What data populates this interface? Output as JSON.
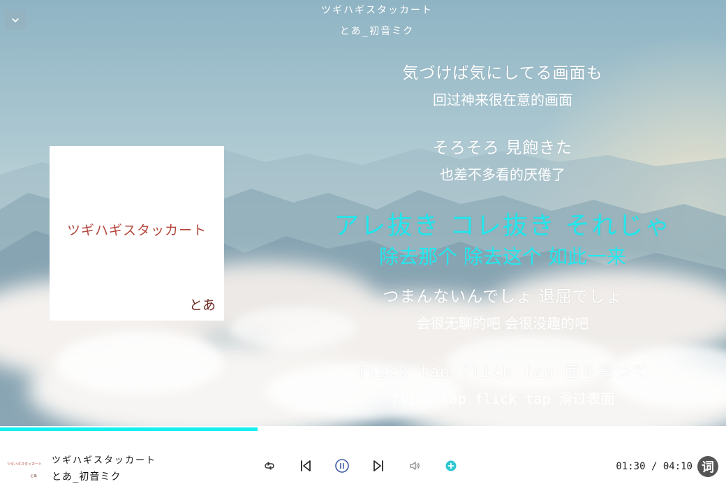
{
  "song": {
    "title": "ツギハギスタッカート",
    "artist": "とあ_初音ミク"
  },
  "cover": {
    "title": "ツギハギスタッカート",
    "artist": "とあ"
  },
  "lyrics": [
    {
      "jp": "気づけば気にしてる画面も",
      "cn": "回过神来很在意的画面",
      "active": false
    },
    {
      "jp": "そろそろ 見飽きた",
      "cn": "也差不多看的厌倦了",
      "active": false
    },
    {
      "jp": "アレ抜き コレ抜き それじゃ",
      "cn": "除去那个 除去这个 如此一来",
      "active": true
    },
    {
      "jp": "つまんないんでしょ 退屈でしょ",
      "cn": "会很无聊的吧 会很没趣的吧",
      "active": false
    },
    {
      "jp": "flick tap flick tap 面を滑つて",
      "cn": "flick tap flick tap 滑过表面",
      "active": false
    }
  ],
  "playback": {
    "current_time": "01:30",
    "separator": "/",
    "total_time": "04:10",
    "progress": 0.355,
    "state": "playing"
  },
  "controls": {
    "lyrics_toggle_label": "词"
  },
  "icons": {
    "collapse": "chevron-down-icon",
    "loop": "repeat-icon",
    "previous": "skip-previous-icon",
    "play_pause": "pause-icon",
    "next": "skip-next-icon",
    "volume": "volume-icon",
    "add": "plus-circle-icon"
  },
  "colors": {
    "accent": "#14f0f0",
    "active_lyric": "#22e8ee",
    "add_button": "#2ec7d1",
    "play_button": "#3d5ba8"
  }
}
